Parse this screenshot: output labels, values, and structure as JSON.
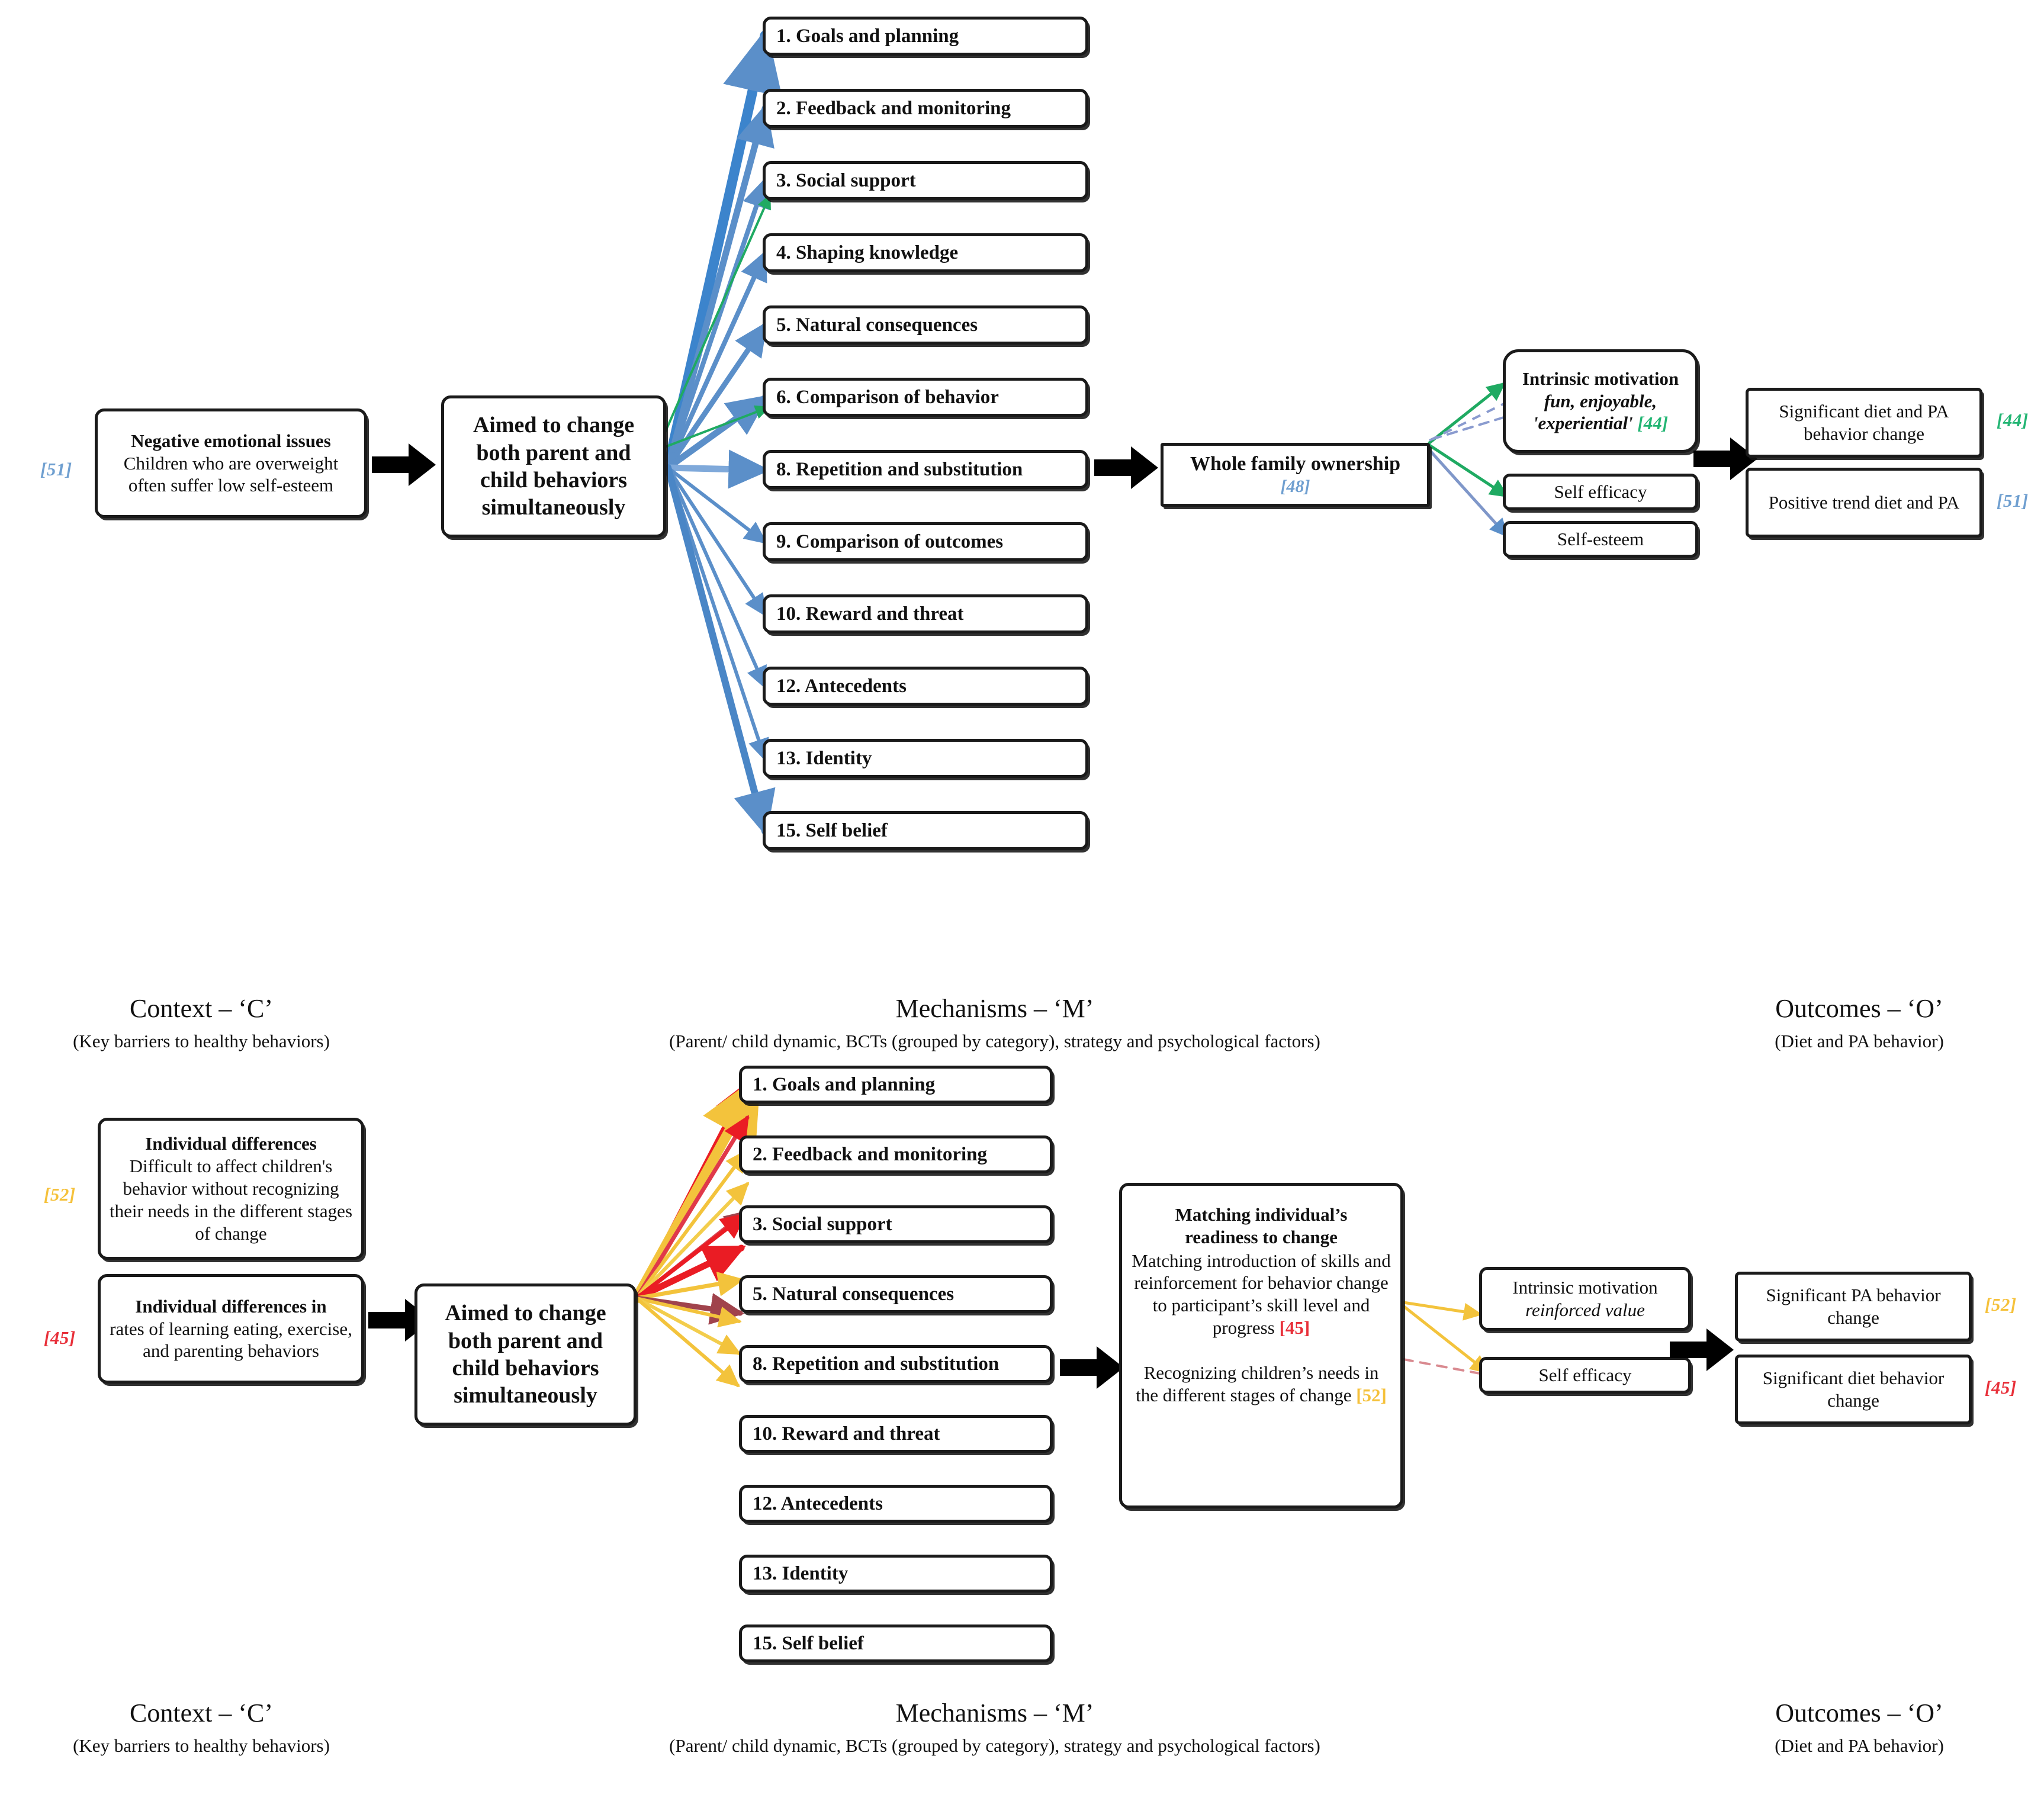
{
  "colors": {
    "ref_blue": "#6f9fd0",
    "ref_green": "#22b573",
    "ref_yellow": "#f5c13b",
    "ref_red": "#e8303a",
    "wire_blue": "#5b8fc9",
    "wire_green": "#1faa62",
    "wire_yellow": "#f3c33c",
    "wire_red": "#ea1c24",
    "wire_maroon": "#a0434c",
    "box_border": "#1a1a1a",
    "text": "#111111"
  },
  "top_diagram": {
    "context": {
      "ref": "[51]",
      "ref_color": "#6f9fd0",
      "title": "Negative emotional issues",
      "body": "Children who are overweight often suffer low self-esteem"
    },
    "strategy": {
      "lines": [
        "Aimed to change",
        "both parent and",
        "child behaviors",
        "simultaneously"
      ]
    },
    "bcts": [
      "1. Goals and planning",
      "2. Feedback and monitoring",
      "3. Social support",
      "4. Shaping knowledge",
      "5. Natural consequences",
      "6. Comparison of behavior",
      "8. Repetition and substitution",
      "9. Comparison of outcomes",
      "10. Reward and threat",
      "12. Antecedents",
      "13. Identity",
      "15. Self belief"
    ],
    "mediator": {
      "title": "Whole family ownership",
      "ref": "[48]",
      "ref_color": "#6f9fd0"
    },
    "psych_factors": [
      {
        "title": "Intrinsic motivation",
        "sub": "fun, enjoyable, 'experiential'",
        "ref": "[44]",
        "ref_color": "#22b573",
        "rounded": true
      },
      {
        "title": "Self efficacy",
        "sub": "",
        "ref": "",
        "ref_color": "",
        "rounded": false
      },
      {
        "title": "Self-esteem",
        "sub": "",
        "ref": "",
        "ref_color": "",
        "rounded": false
      }
    ],
    "outcomes": [
      {
        "text": "Significant diet and PA behavior change",
        "ref": "[44]",
        "ref_color": "#22b573"
      },
      {
        "text": "Positive trend diet and PA",
        "ref": "[51]",
        "ref_color": "#6f9fd0"
      }
    ]
  },
  "column_headers_top": [
    {
      "t1": "Context – ‘C’",
      "t2": "(Key barriers to healthy behaviors)"
    },
    {
      "t1": "Mechanisms – ‘M’",
      "t2": "(Parent/ child dynamic, BCTs (grouped by category), strategy and psychological factors)"
    },
    {
      "t1": "Outcomes – ‘O’",
      "t2": "(Diet and PA behavior)"
    }
  ],
  "column_headers_bottom": [
    {
      "t1": "Context – ‘C’",
      "t2": "(Key barriers to healthy behaviors)"
    },
    {
      "t1": "Mechanisms – ‘M’",
      "t2": "(Parent/ child dynamic, BCTs (grouped by category), strategy and psychological factors)"
    },
    {
      "t1": "Outcomes – ‘O’",
      "t2": "(Diet and PA behavior)"
    }
  ],
  "bottom_diagram": {
    "contexts": [
      {
        "ref": "[52]",
        "ref_color": "#f5c13b",
        "title": "Individual differences",
        "body": "Difficult to affect children's behavior without recognizing their needs in the different stages of change"
      },
      {
        "ref": "[45]",
        "ref_color": "#e8303a",
        "title": "Individual differences in",
        "body": "rates of learning eating, exercise, and parenting behaviors"
      }
    ],
    "strategy": {
      "lines": [
        "Aimed to change",
        "both parent and",
        "child behaviors",
        "simultaneously"
      ]
    },
    "bcts": [
      "1. Goals and planning",
      "2. Feedback and monitoring",
      "3. Social support",
      "5. Natural consequences",
      "8. Repetition and substitution",
      "10. Reward and threat",
      "12. Antecedents",
      "13. Identity",
      "15. Self belief"
    ],
    "mediator": {
      "title_lines": [
        "Matching individual’s",
        "readiness to change"
      ],
      "para1": "Matching introduction of skills and reinforcement for behavior change to participant’s skill level and progress ",
      "para1_ref": "[45]",
      "para1_ref_color": "#e8303a",
      "para2": "Recognizing children’s needs in the different stages of change ",
      "para2_ref": "[52]",
      "para2_ref_color": "#f5c13b"
    },
    "psych_factors": [
      {
        "title": "Intrinsic motivation",
        "sub": "reinforced value"
      },
      {
        "title": "Self efficacy",
        "sub": ""
      }
    ],
    "outcomes": [
      {
        "text": "Significant PA behavior change",
        "ref": "[52]",
        "ref_color": "#f5c13b"
      },
      {
        "text": "Significant diet behavior change",
        "ref": "[45]",
        "ref_color": "#e8303a"
      }
    ]
  }
}
